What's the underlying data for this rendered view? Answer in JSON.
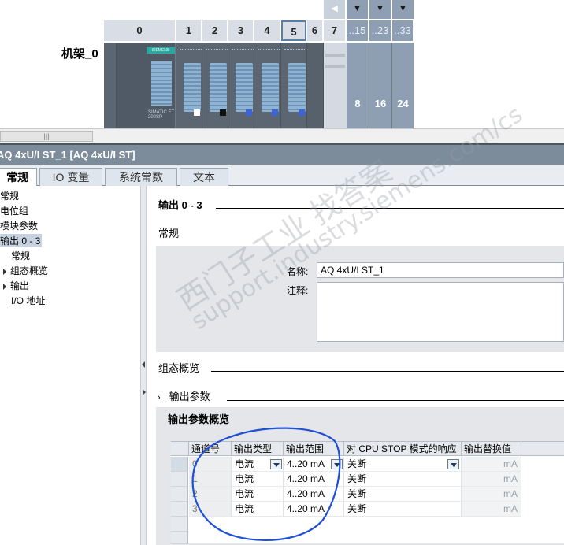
{
  "rack": {
    "label": "机架_0",
    "slots": [
      "0",
      "1",
      "2",
      "3",
      "4",
      "5",
      "6",
      "7",
      "..15",
      "..23",
      "..33"
    ],
    "extension_numbers": [
      "8",
      "16",
      "24"
    ],
    "head_brand": "SIEMENS",
    "head_text": "SIMATIC ET 200SP"
  },
  "properties": {
    "title": "AQ 4xU/I ST_1 [AQ 4xU/I ST]",
    "tabs": [
      "常规",
      "IO 变量",
      "系统常数",
      "文本"
    ]
  },
  "nav": {
    "items": [
      {
        "label": "常规"
      },
      {
        "label": "电位组"
      },
      {
        "label": "模块参数"
      },
      {
        "label": "输出 0 - 3"
      },
      {
        "label": "常规"
      },
      {
        "label": "组态概览"
      },
      {
        "label": "输出"
      },
      {
        "label": "I/O 地址"
      }
    ]
  },
  "content": {
    "section_title": "输出 0 - 3",
    "general_title": "常规",
    "name_label": "名称:",
    "name_value": "AQ 4xU/I ST_1",
    "comment_label": "注释:",
    "comment_value": "",
    "config_overview_title": "组态概览",
    "output_params_title": "输出参数",
    "output_params_overview_title": "输出参数概览"
  },
  "table": {
    "headers": [
      "通道号",
      "输出类型",
      "输出范围",
      "对 CPU STOP 模式的响应",
      "输出替换值"
    ],
    "rows": [
      {
        "channel": "0",
        "type": "电流",
        "range": "4..20 mA",
        "stop": "关断",
        "unit": "mA"
      },
      {
        "channel": "1",
        "type": "电流",
        "range": "4..20 mA",
        "stop": "关断",
        "unit": "mA"
      },
      {
        "channel": "2",
        "type": "电流",
        "range": "4..20 mA",
        "stop": "关断",
        "unit": "mA"
      },
      {
        "channel": "3",
        "type": "电流",
        "range": "4..20 mA",
        "stop": "关断",
        "unit": "mA"
      }
    ]
  },
  "watermark": {
    "line1": "西门子工业 找答案",
    "line2": "support.industry.siemens.com/cs"
  },
  "colors": {
    "title_bar": "#7d8c9b",
    "annotation_circle": "#1f4fd6",
    "selection": "#c7d3e0"
  }
}
